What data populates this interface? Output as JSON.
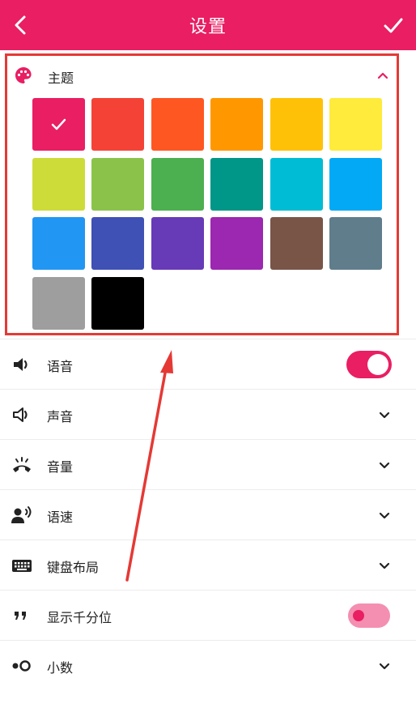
{
  "header": {
    "title": "设置",
    "bg_color": "#e91e63"
  },
  "theme": {
    "label": "主题",
    "selected_index": 0,
    "swatches": [
      "#e91e63",
      "#f44336",
      "#ff5722",
      "#ff9800",
      "#ffc107",
      "#ffeb3b",
      "#cddc39",
      "#8bc34a",
      "#4caf50",
      "#009688",
      "#00bcd4",
      "#03a9f4",
      "#2196f3",
      "#3f51b5",
      "#673ab7",
      "#9c27b0",
      "#795548",
      "#607d8b",
      "#9e9e9e",
      "#000000"
    ]
  },
  "settings": {
    "voice": {
      "label": "语音",
      "toggle_on": true
    },
    "sound": {
      "label": "声音"
    },
    "volume": {
      "label": "音量"
    },
    "speech_rate": {
      "label": "语速"
    },
    "keyboard_layout": {
      "label": "键盘布局"
    },
    "thousands_separator": {
      "label": "显示千分位",
      "toggle_on": false
    },
    "decimal": {
      "label": "小数"
    }
  },
  "annotation": {
    "highlight_color": "#e53935"
  }
}
